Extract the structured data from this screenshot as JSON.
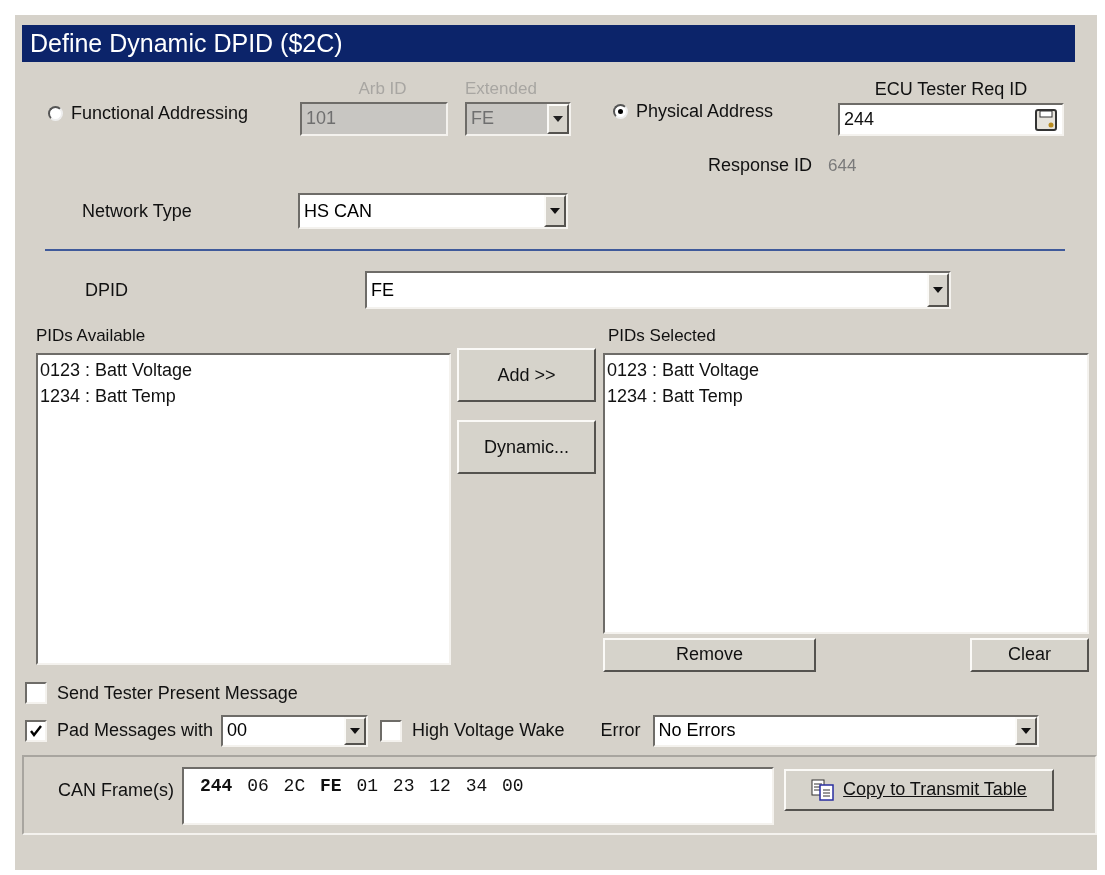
{
  "title": "Define Dynamic DPID ($2C)",
  "addressing": [
    {
      "label": "Functional Addressing",
      "selected": false
    },
    {
      "label": "Physical Address",
      "selected": true
    }
  ],
  "arb_id": {
    "label": "Arb ID",
    "value": "101",
    "disabled": true
  },
  "extended": {
    "label": "Extended",
    "value": "FE",
    "disabled": true
  },
  "ecu_tester_req_id": {
    "label": "ECU Tester Req ID",
    "value": "244"
  },
  "response_id": {
    "label": "Response ID",
    "value": "644"
  },
  "network_type": {
    "label": "Network Type",
    "value": "HS CAN"
  },
  "dpid": {
    "label": "DPID",
    "value": "FE"
  },
  "pids_available": {
    "label": "PIDs Available",
    "items": [
      "0123 : Batt Voltage",
      "1234 : Batt Temp"
    ]
  },
  "middle_buttons": [
    "Add >>",
    "Dynamic..."
  ],
  "pids_selected": {
    "label": "PIDs Selected",
    "items": [
      "0123 : Batt Voltage",
      "1234 : Batt Temp"
    ]
  },
  "list_buttons": [
    "Remove",
    "Clear"
  ],
  "send_tester_present": {
    "label": "Send Tester Present Message",
    "checked": false
  },
  "pad_messages": {
    "label": "Pad Messages with",
    "checked": true,
    "value": "00"
  },
  "high_voltage_wake": {
    "label": "High Voltage Wake",
    "checked": false
  },
  "error": {
    "label": "Error",
    "value": "No Errors"
  },
  "can_frames": {
    "label": "CAN Frame(s)",
    "value": "**244** 06 2C **FE** 01 23 12 34 00"
  },
  "copy_button": "Copy to Transmit Table"
}
